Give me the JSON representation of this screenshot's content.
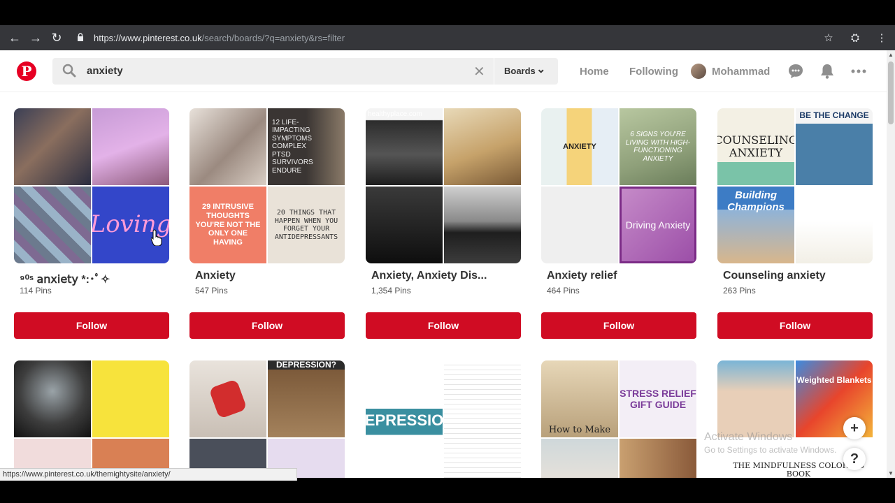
{
  "browser": {
    "url_domain": "https://www.pinterest.co.uk",
    "url_path": "/search/boards/?q=anxiety&rs=filter",
    "back_icon": "←",
    "forward_icon": "→",
    "reload_icon": "↻",
    "lock_icon": "🔒",
    "star_icon": "☆",
    "incognito_icon": "⛭",
    "menu_icon": "⋮"
  },
  "header": {
    "logo": "P",
    "search_value": "anxiety",
    "clear_icon": "✕",
    "filter_label": "Boards",
    "filter_chevron": "⌄",
    "nav_home": "Home",
    "nav_following": "Following",
    "user_name": "Mohammad"
  },
  "boards": [
    {
      "title": "⁹⁰ˢ 𝖺𝗇𝗑𝗂𝖾𝗍𝗒 *:･ﾟ✧",
      "pins": "114 Pins",
      "follow": "Follow",
      "tiles": [
        "",
        "",
        "",
        "Loving"
      ]
    },
    {
      "title": "Anxiety",
      "pins": "547 Pins",
      "follow": "Follow",
      "tiles": [
        "",
        "12 LIFE-IMPACTING SYMPTOMS COMPLEX PTSD SURVIVORS ENDURE",
        "29 INTRUSIVE THOUGHTS YOU'RE NOT THE ONLY ONE HAVING",
        "20 THINGS THAT HAPPEN WHEN YOU FORGET YOUR ANTIDEPRESSANTS"
      ]
    },
    {
      "title": "Anxiety, Anxiety Dis...",
      "pins": "1,354 Pins",
      "follow": "Follow",
      "tiles": [
        "healthyplace.com",
        "",
        "",
        ""
      ]
    },
    {
      "title": "Anxiety relief",
      "pins": "464 Pins",
      "follow": "Follow",
      "tiles": [
        "ANXIETY",
        "6 SIGNS YOU'RE LIVING WITH HIGH-FUNCTIONING ANXIETY",
        "",
        "Driving Anxiety"
      ]
    },
    {
      "title": "Counseling anxiety",
      "pins": "263 Pins",
      "follow": "Follow",
      "tiles": [
        "COUNSELING ANXIETY",
        "BE THE CHANGE",
        "Building Champions",
        ""
      ]
    }
  ],
  "row2_tiles": [
    "",
    "",
    "DEPRESSION?",
    "EPRESSIO",
    "STRESS RELIEF GIFT GUIDE",
    "How to Make",
    "Weighted Blankets",
    "THE MINDFULNESS COLORING BOOK"
  ],
  "fab": {
    "add": "+",
    "help": "?"
  },
  "watermark": {
    "line1": "Activate Windows",
    "line2": "Go to Settings to activate Windows."
  },
  "status_url": "https://www.pinterest.co.uk/themightysite/anxiety/",
  "colors": {
    "brand": "#e60023",
    "follow_button": "#d00c23"
  }
}
